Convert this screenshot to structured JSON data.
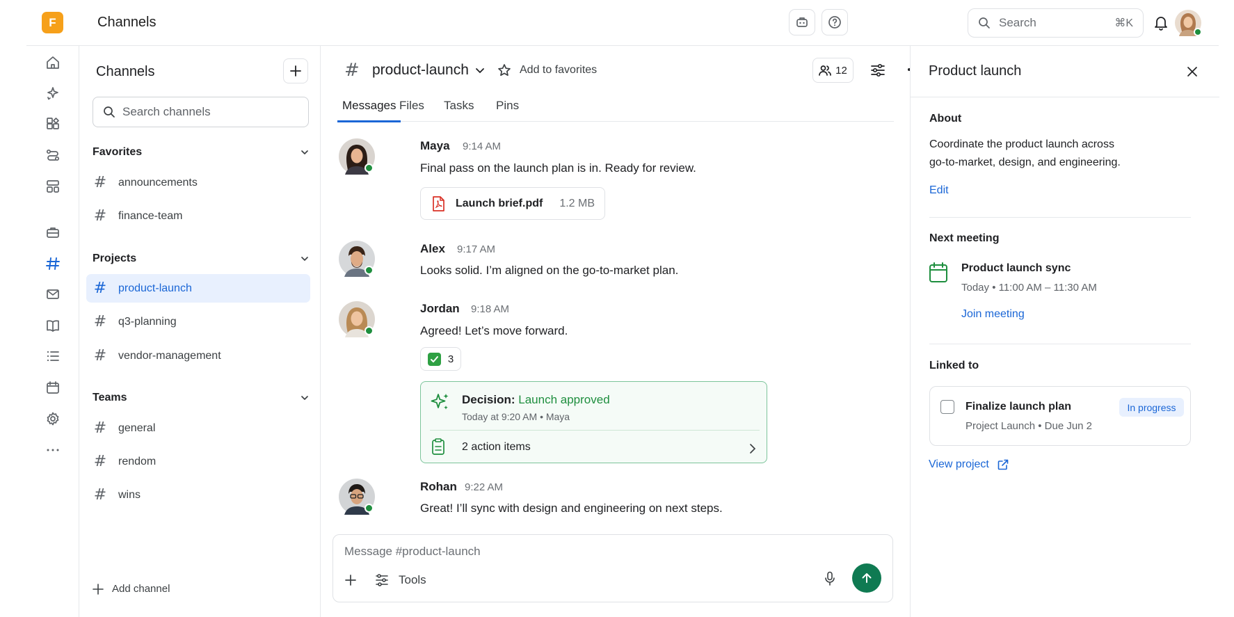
{
  "app": {
    "logo_letter": "F",
    "title": "Channels"
  },
  "topbar": {
    "search_placeholder": "Search",
    "search_shortcut": "⌘K"
  },
  "rail": {
    "items": [
      "home-icon",
      "sparkle-icon",
      "apps-icon",
      "workflow-icon",
      "dashboard-icon",
      "briefcase-icon",
      "channels-icon",
      "mail-icon",
      "book-icon",
      "list-icon",
      "calendar-icon",
      "settings-icon",
      "more-icon"
    ],
    "active": "channels-icon"
  },
  "sidebar": {
    "title": "Channels",
    "search_placeholder": "Search channels",
    "sections": [
      {
        "label": "Favorites",
        "channels": [
          "announcements",
          "finance-team"
        ]
      },
      {
        "label": "Projects",
        "channels": [
          "product-launch",
          "q3-planning",
          "vendor-management"
        ]
      },
      {
        "label": "Teams",
        "channels": [
          "general",
          "rendom",
          "wins"
        ]
      }
    ],
    "active_channel": "product-launch",
    "add_channel": "Add channel"
  },
  "channel": {
    "hash": "#",
    "name": "product-launch",
    "favorite_label": "Add to favorites",
    "member_count": "12",
    "tabs": [
      "Messages",
      "Files",
      "Tasks",
      "Pins"
    ],
    "active_tab": "Messages"
  },
  "messages": [
    {
      "author": "Maya",
      "time": "9:14 AM",
      "text": "Final pass on the launch plan is in. Ready for review.",
      "attachment": {
        "name": "Launch brief.pdf",
        "size": "1.2 MB"
      }
    },
    {
      "author": "Alex",
      "time": "9:17 AM",
      "text": "Looks solid. I’m aligned on the go-to-market plan."
    },
    {
      "author": "Jordan",
      "time": "9:18 AM",
      "text": "Agreed! Let’s move forward.",
      "reaction": {
        "emoji": "check-mark",
        "count": "3"
      },
      "decision": {
        "label": "Decision:",
        "value": "Launch approved",
        "meta": "Today at 9:20 AM • Maya",
        "actions": "2 action items"
      }
    },
    {
      "author": "Rohan",
      "time": "9:22 AM",
      "text": "Great! I’ll sync with design and engineering on next steps."
    }
  ],
  "composer": {
    "placeholder": "Message #product-launch",
    "tools_label": "Tools"
  },
  "panel": {
    "title": "Product launch",
    "about_label": "About",
    "about_line1": "Coordinate the product launch across",
    "about_line2": "go-to-market, design, and engineering.",
    "edit_label": "Edit",
    "next_meeting_label": "Next meeting",
    "meeting_title": "Product launch sync",
    "meeting_time": "Today • 11:00 AM – 11:30 AM",
    "join_label": "Join meeting",
    "linked_label": "Linked to",
    "task": {
      "title": "Finalize launch plan",
      "meta": "Project Launch • Due Jun 2",
      "status": "In progress"
    },
    "view_project": "View project"
  },
  "colors": {
    "accent": "#1a66d6",
    "logo": "#f6a01a",
    "success": "#1e8e3e",
    "send": "#0f7a52",
    "active_bg": "#e8f0fe"
  }
}
